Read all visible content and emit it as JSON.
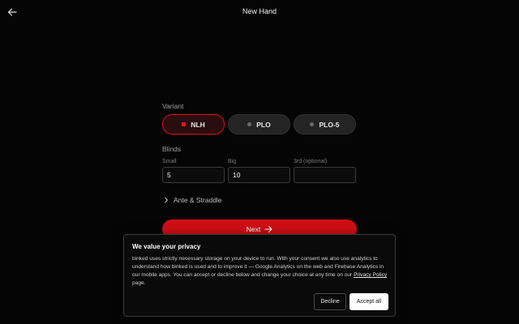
{
  "header": {
    "title": "New Hand",
    "back_icon": "arrow-left-icon"
  },
  "variant": {
    "label": "Variant",
    "options": [
      {
        "label": "NLH",
        "selected": true
      },
      {
        "label": "PLO",
        "selected": false
      },
      {
        "label": "PLO-5",
        "selected": false
      }
    ]
  },
  "blinds": {
    "label": "Blinds",
    "small": {
      "label": "Small",
      "value": "5"
    },
    "big": {
      "label": "Big",
      "value": "10"
    },
    "third": {
      "label": "3rd (optional)",
      "value": ""
    }
  },
  "ante": {
    "label": "Ante & Straddle",
    "icon": "chevron-right-icon"
  },
  "next": {
    "label": "Next",
    "icon": "arrow-right-icon"
  },
  "consent": {
    "title": "We value your privacy",
    "text_before_link": "binked uses strictly necessary storage on your device to run. With your consent we also use analytics to understand how binked is used and to improve it — Google Analytics on the web and Firebase Analytics in our mobile apps. You can accept or decline below and change your choice at any time on our ",
    "link_text": "Privacy Policy",
    "text_after_link": " page.",
    "decline_label": "Decline",
    "accept_label": "Accept all"
  },
  "colors": {
    "accent": "#d00f15",
    "background": "#050505"
  }
}
